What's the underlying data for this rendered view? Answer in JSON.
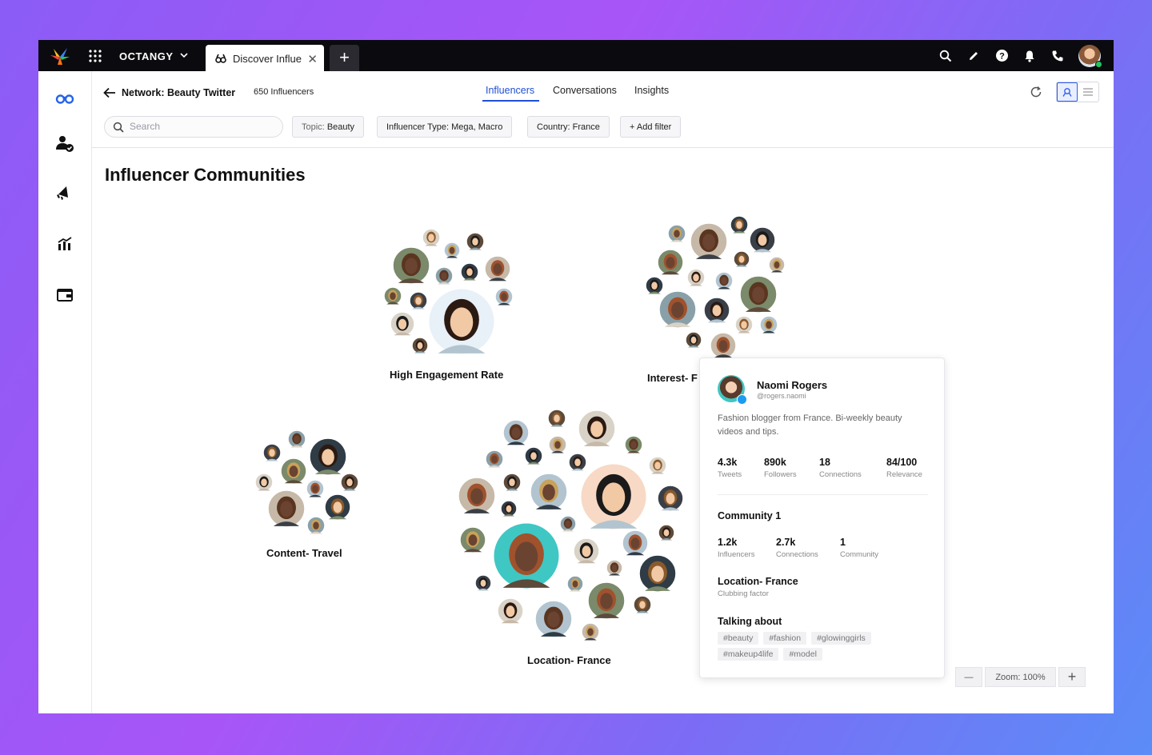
{
  "app": {
    "brand": "OCTANGY",
    "tab_title": "Discover Influencers",
    "tab_close": "✕",
    "new_tab": "+"
  },
  "header": {
    "network_title": "Network: Beauty Twitter",
    "influencer_count": "650 Influencers",
    "nav_tabs": [
      "Influencers",
      "Conversations",
      "Insights"
    ],
    "active_tab": "Influencers"
  },
  "filters": {
    "search_placeholder": "Search",
    "chips": [
      {
        "key": "Topic:",
        "value": "Beauty"
      },
      {
        "key": "Influencer Type:",
        "value": "Mega, Macro"
      },
      {
        "key": "Country:",
        "value": "France"
      },
      {
        "key": "",
        "value": "+ Add filter"
      }
    ]
  },
  "main": {
    "title": "Influencer Communities",
    "clusters": [
      {
        "label": "High Engagement Rate"
      },
      {
        "label": "Interest- F"
      },
      {
        "label": "Content- Travel"
      },
      {
        "label": "Location- France"
      }
    ]
  },
  "profile_card": {
    "name": "Naomi Rogers",
    "handle": "@rogers.naomi",
    "bio": "Fashion blogger from France. Bi-weekly beauty videos and tips.",
    "stats": [
      {
        "value": "4.3k",
        "label": "Tweets"
      },
      {
        "value": "890k",
        "label": "Followers"
      },
      {
        "value": "18",
        "label": "Connections"
      },
      {
        "value": "84/100",
        "label": "Relevance"
      }
    ],
    "community_title": "Community 1",
    "community_stats": [
      {
        "value": "1.2k",
        "label": "Influencers"
      },
      {
        "value": "2.7k",
        "label": "Connections"
      },
      {
        "value": "1",
        "label": "Community"
      }
    ],
    "location_title": "Location- France",
    "location_sub": "Clubbing factor",
    "talking_title": "Talking about",
    "tags": [
      "#beauty",
      "#fashion",
      "#glowinggirls",
      "#makeup4life",
      "#model"
    ]
  },
  "zoom": {
    "minus": "—",
    "label": "Zoom: 100%",
    "plus": "+"
  },
  "icons": {
    "search": "search-icon",
    "edit": "pencil-icon",
    "help": "help-icon",
    "bell": "bell-icon",
    "phone": "phone-icon"
  },
  "colors": {
    "accent": "#1f4fd6",
    "topbar": "#0b0b0f",
    "verified": "#1d9bf0",
    "online": "#22c55e"
  }
}
